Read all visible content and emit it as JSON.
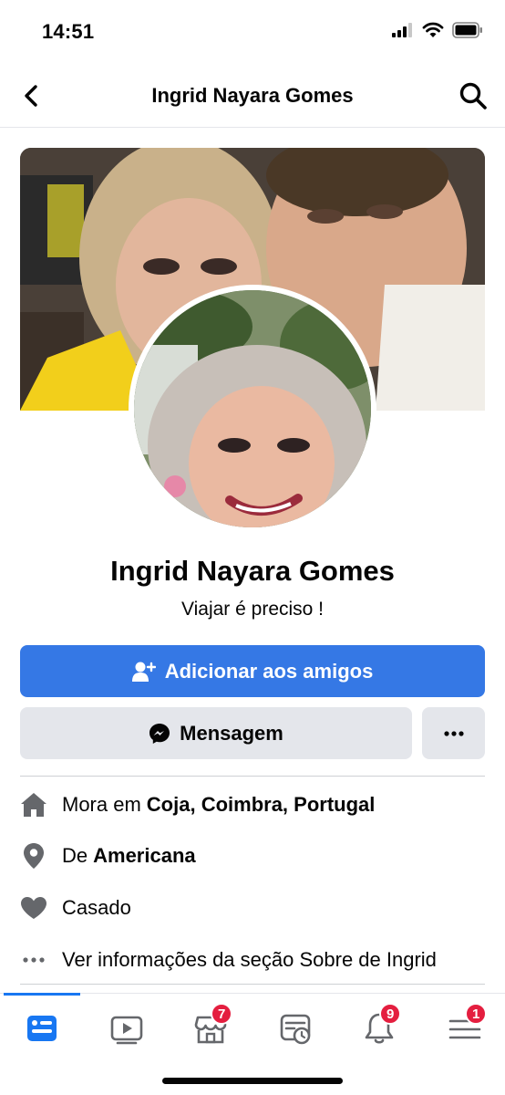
{
  "status_bar": {
    "time": "14:51"
  },
  "header": {
    "title": "Ingrid Nayara Gomes"
  },
  "profile": {
    "name": "Ingrid Nayara Gomes",
    "bio": "Viajar é preciso !"
  },
  "actions": {
    "add_friend_label": "Adicionar aos amigos",
    "message_label": "Mensagem"
  },
  "info": {
    "lives_prefix": "Mora em",
    "lives_place": "Coja, Coimbra, Portugal",
    "from_prefix": "De",
    "from_place": "Americana",
    "relationship": "Casado",
    "about_link": "Ver informações da seção Sobre de Ingrid"
  },
  "tabbar": {
    "items": [
      {
        "icon": "news-feed-icon",
        "badge": ""
      },
      {
        "icon": "watch-icon",
        "badge": ""
      },
      {
        "icon": "marketplace-icon",
        "badge": "7"
      },
      {
        "icon": "memories-icon",
        "badge": ""
      },
      {
        "icon": "notifications-bell-icon",
        "badge": "9"
      },
      {
        "icon": "menu-icon",
        "badge": "1"
      }
    ]
  },
  "colors": {
    "accent": "#3578e5",
    "secondary_button": "#e4e6eb",
    "badge": "#e41e3f",
    "tab_active": "#1877f2",
    "icon_gray": "#65676b"
  }
}
